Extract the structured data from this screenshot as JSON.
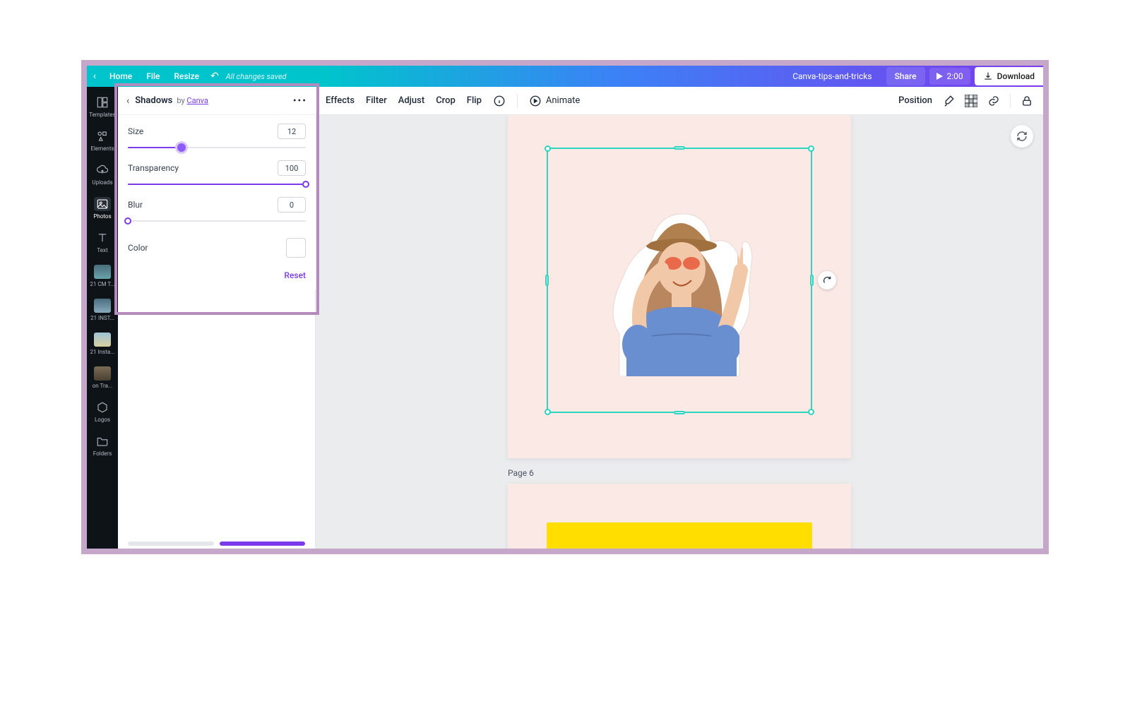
{
  "top": {
    "home": "Home",
    "file": "File",
    "resize": "Resize",
    "saved": "All changes saved",
    "doc_title": "Canva-tips-and-tricks",
    "share": "Share",
    "time": "2:00",
    "download": "Download"
  },
  "rail": {
    "templates": "Templates",
    "elements": "Elements",
    "uploads": "Uploads",
    "photos": "Photos",
    "text": "Text",
    "logos": "Logos",
    "folders": "Folders",
    "thumbs": [
      "21 CM T...",
      "21 INST...",
      "21 Insta...",
      "on Tra..."
    ]
  },
  "panel": {
    "title": "Shadows",
    "by_prefix": "by ",
    "by_link": "Canva",
    "size_label": "Size",
    "size_value": "12",
    "size_pct": 30,
    "transparency_label": "Transparency",
    "transparency_value": "100",
    "transparency_pct": 100,
    "blur_label": "Blur",
    "blur_value": "0",
    "blur_pct": 0,
    "color_label": "Color",
    "reset": "Reset"
  },
  "ctx": {
    "effects": "Effects",
    "filter": "Filter",
    "adjust": "Adjust",
    "crop": "Crop",
    "flip": "Flip",
    "animate": "Animate",
    "position": "Position"
  },
  "page6_label": "Page 6"
}
